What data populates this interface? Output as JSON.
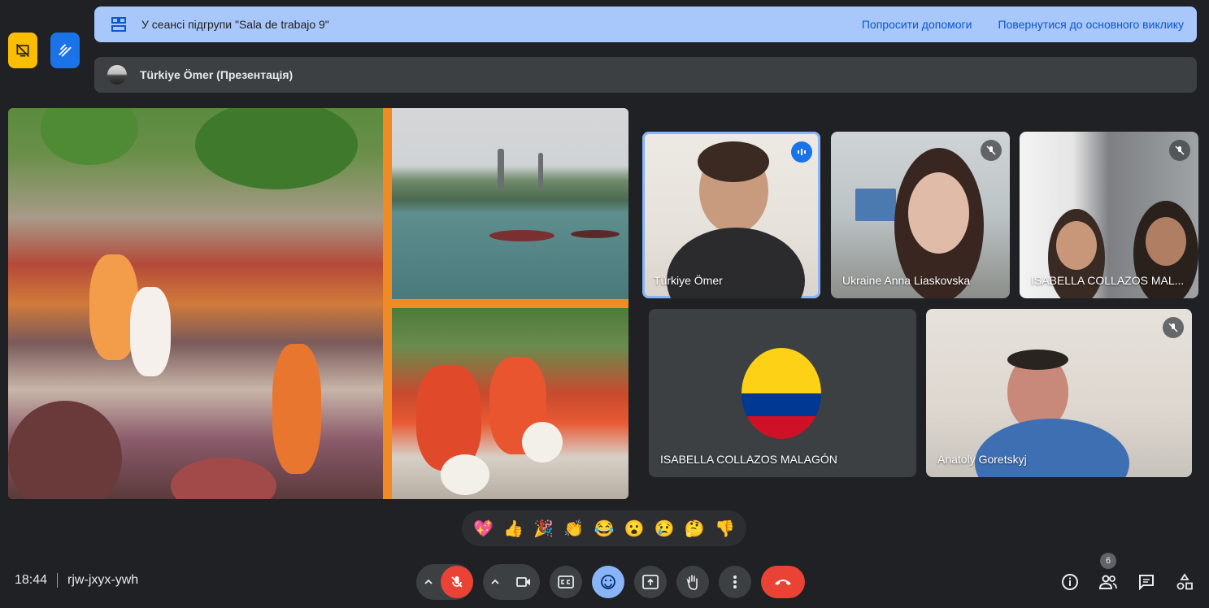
{
  "breakout": {
    "title": "У сеансі підгрупи \"Sala de trabajo 9\"",
    "help_label": "Попросити допомоги",
    "return_label": "Повернутися до основного виклику"
  },
  "presentation": {
    "label": "Türkiye Ömer (Презентація)"
  },
  "participants": [
    {
      "name": "Türkiye Ömer",
      "muted": false,
      "speaking": true
    },
    {
      "name": "Ukraine Anna Liaskovska",
      "muted": true
    },
    {
      "name": "ISABELLA COLLAZOS MAL...",
      "muted": true
    },
    {
      "name": "ISABELLA COLLAZOS MALAGÓN",
      "muted": false,
      "avatar": "colombia-flag"
    },
    {
      "name": "Anatoly Goretskyj",
      "muted": true
    }
  ],
  "reactions": [
    "💖",
    "👍",
    "🎉",
    "👏",
    "😂",
    "😮",
    "😢",
    "🤔",
    "👎"
  ],
  "meeting": {
    "time": "18:44",
    "code": "rjw-jxyx-ywh"
  },
  "people_count": "6",
  "colors": {
    "background": "#202124",
    "breakout_bar": "#a8c7fa",
    "accent_blue": "#8ab4f8",
    "end_call_red": "#ea4335",
    "side_yellow": "#fbbc04",
    "side_blue": "#1a73e8"
  }
}
